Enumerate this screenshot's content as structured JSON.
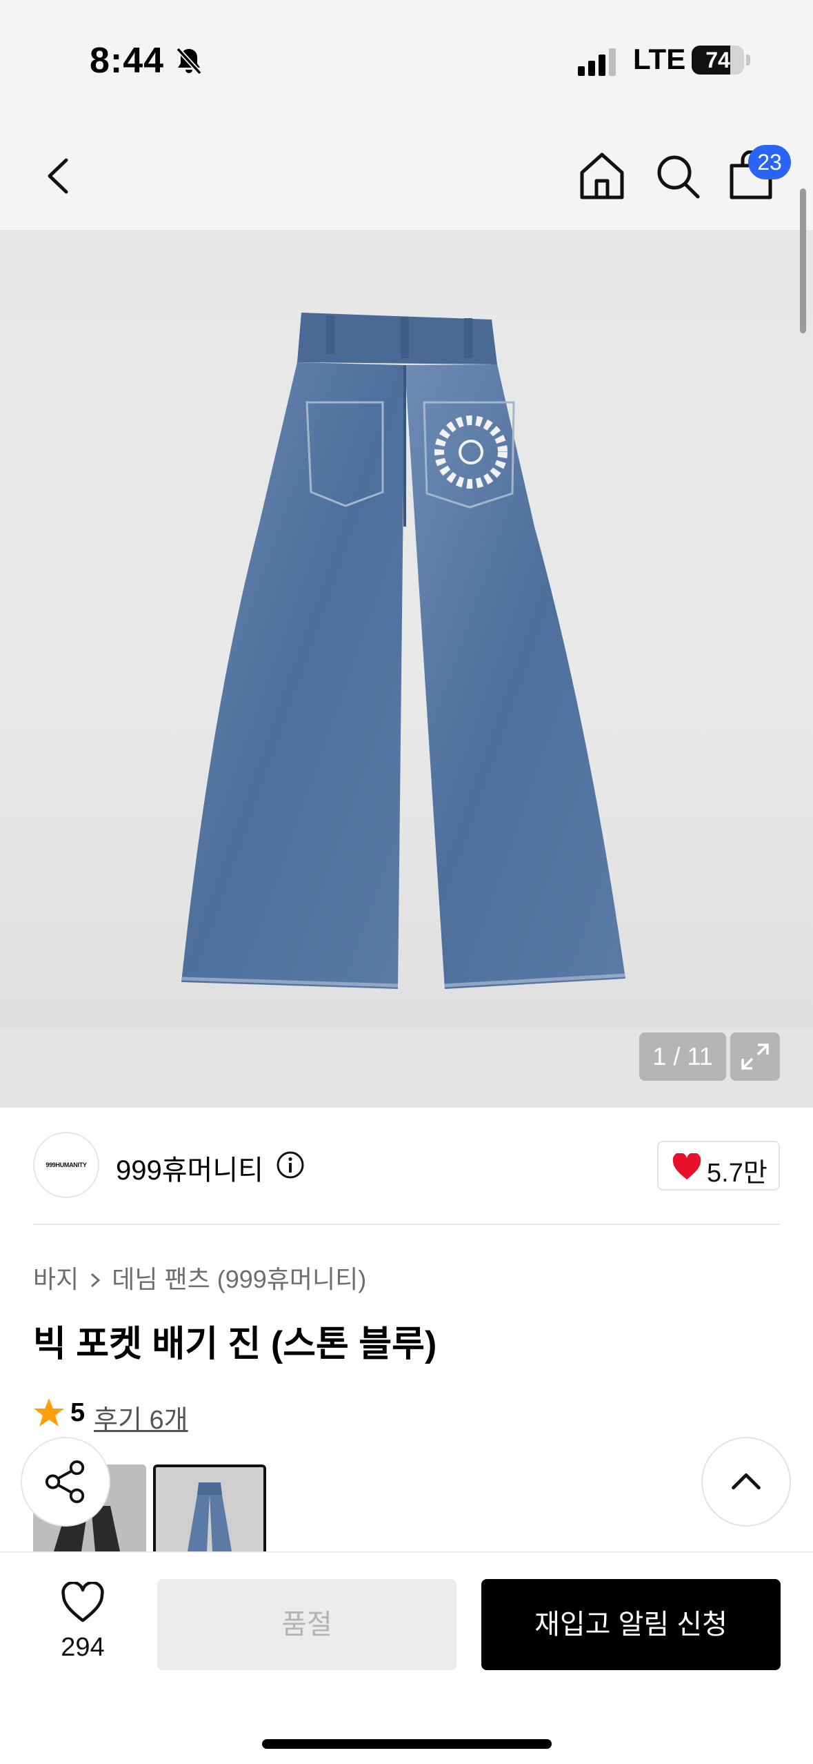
{
  "status_bar": {
    "time": "8:44",
    "network": "LTE",
    "battery_level": "74",
    "battery_fraction": 0.74
  },
  "header": {
    "cart_count": "23"
  },
  "gallery": {
    "counter": "1 / 11"
  },
  "brand": {
    "logo_text": "999HUMANITY",
    "name": "999휴머니티",
    "like_count": "5.7만"
  },
  "product": {
    "breadcrumb": [
      "바지",
      "데님 팬츠 (999휴머니티)"
    ],
    "title": "빅 포켓 배기 진 (스톤 블루)",
    "rating": "5",
    "review_link": "후기 6개"
  },
  "bottom_bar": {
    "wish_count": "294",
    "soldout_label": "품절",
    "restock_label": "재입고 알림 신청"
  },
  "colors": {
    "accent_blue": "#2a64f6",
    "heart_red": "#e8102a",
    "star_orange": "#ff9f0a",
    "primary_black": "#000000"
  },
  "icons": [
    "bell-off-icon",
    "signal-icon",
    "battery-icon",
    "back-chevron-icon",
    "home-icon",
    "search-icon",
    "cart-icon",
    "expand-icon",
    "info-icon",
    "heart-icon",
    "star-icon",
    "share-icon",
    "chevron-up-icon",
    "wishlist-heart-icon"
  ]
}
